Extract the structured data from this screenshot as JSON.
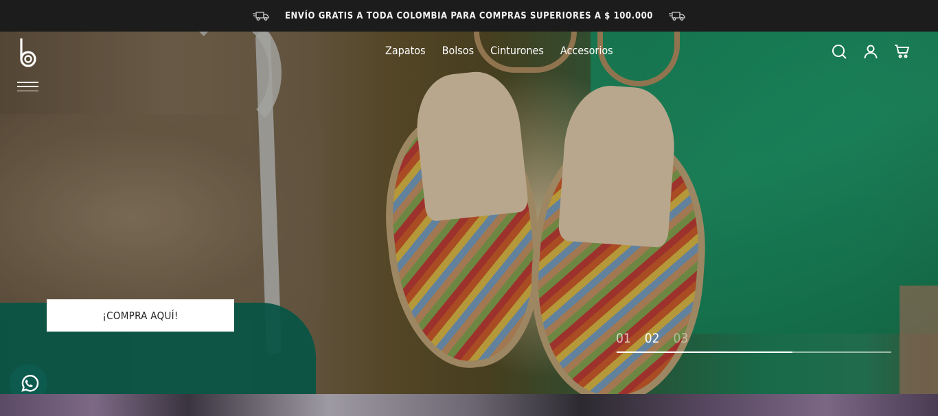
{
  "announcement": {
    "text": "ENVÍO GRATIS A TODA COLOMBIA PARA COMPRAS SUPERIORES A $ 100.000",
    "icon": "delivery-truck-icon"
  },
  "header": {
    "logo": "b",
    "menu_icon": "hamburger-icon",
    "nav": [
      "Zapatos",
      "Bolsos",
      "Cinturones",
      "Accesorios"
    ],
    "icons": [
      "search-icon",
      "user-icon",
      "cart-icon"
    ]
  },
  "hero": {
    "cta_label": "¡COMPRA AQUÍ!",
    "slides": [
      "01",
      "02",
      "03"
    ],
    "active_slide": "02",
    "progress": 0.64
  },
  "colors": {
    "topbar": "#1c1c1c",
    "whatsapp": "#0d5b4e",
    "cta_bg": "#ffffff"
  },
  "whatsapp_icon": "whatsapp-icon"
}
